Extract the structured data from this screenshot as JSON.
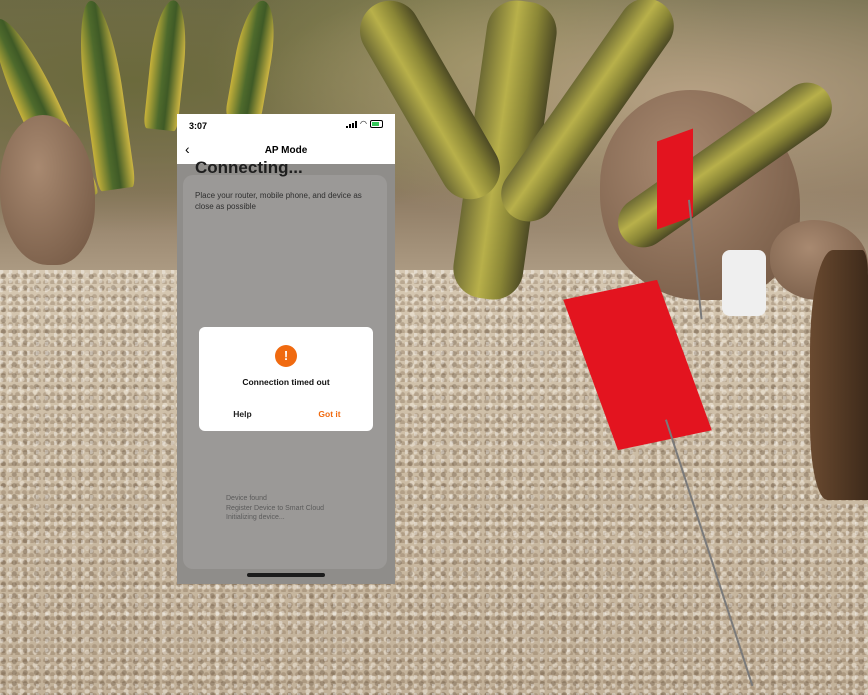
{
  "status_bar": {
    "time": "3:07",
    "icons": [
      "signal-icon",
      "wifi-icon",
      "battery-icon"
    ]
  },
  "nav": {
    "back_icon": "chevron-left",
    "title": "AP Mode"
  },
  "connecting": {
    "title": "Connecting...",
    "description": "Place your router, mobile phone, and device as close as possible"
  },
  "dialog": {
    "icon": "exclamation-circle",
    "message": "Connection timed out",
    "help_label": "Help",
    "gotit_label": "Got it"
  },
  "progress_steps": [
    "Device found",
    "Register Device to Smart Cloud",
    "Initializing device..."
  ],
  "colors": {
    "accent": "#f06a10",
    "screen_overlay": "#8f8d8a",
    "flag_red": "#e3141f"
  }
}
